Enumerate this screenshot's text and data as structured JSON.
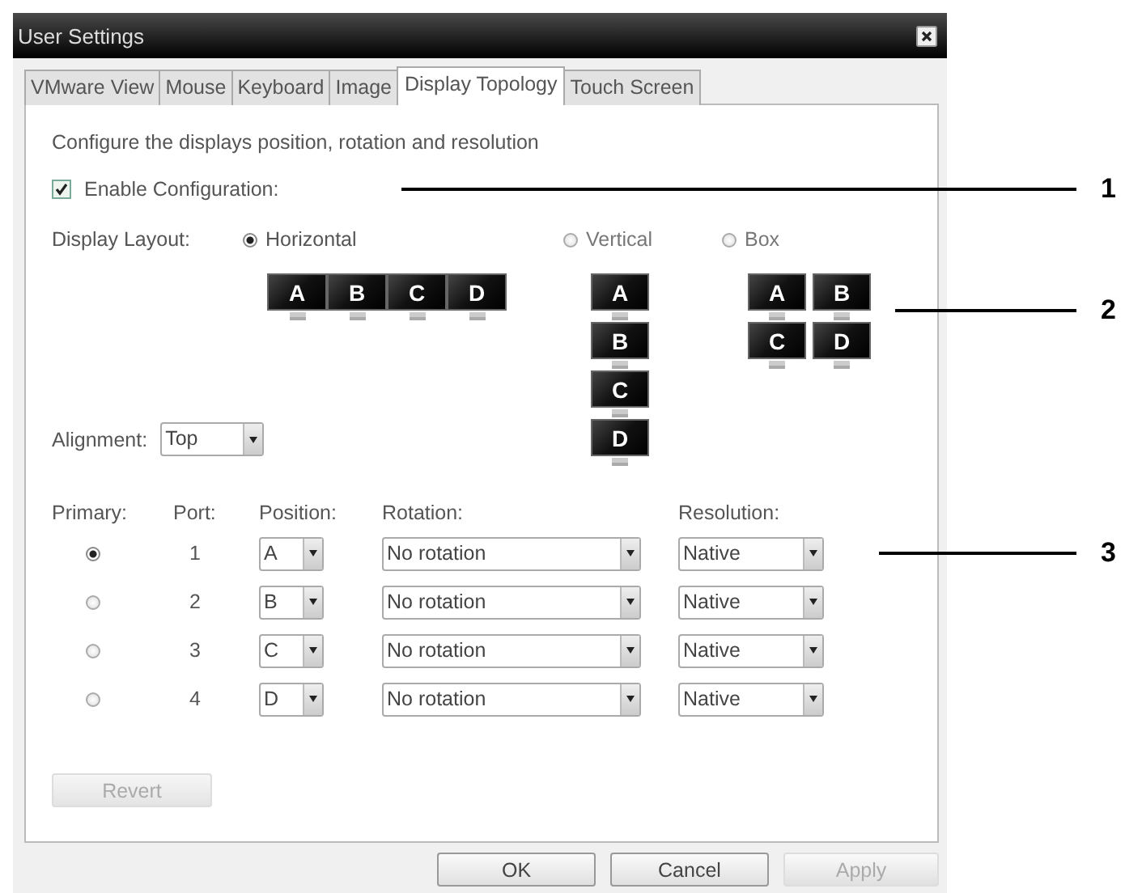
{
  "window": {
    "title": "User Settings"
  },
  "tabs": [
    {
      "label": "VMware View",
      "selected": false
    },
    {
      "label": "Mouse",
      "selected": false
    },
    {
      "label": "Keyboard",
      "selected": false
    },
    {
      "label": "Image",
      "selected": false
    },
    {
      "label": "Display Topology",
      "selected": true
    },
    {
      "label": "Touch Screen",
      "selected": false
    }
  ],
  "description": "Configure the displays position, rotation and resolution",
  "enable_configuration": {
    "label": "Enable Configuration:",
    "checked": true
  },
  "display_layout": {
    "label": "Display Layout:",
    "options": [
      {
        "kind": "horizontal",
        "label": "Horizontal",
        "selected": true,
        "displays": [
          "A",
          "B",
          "C",
          "D"
        ]
      },
      {
        "kind": "vertical",
        "label": "Vertical",
        "selected": false,
        "displays": [
          "A",
          "B",
          "C",
          "D"
        ]
      },
      {
        "kind": "box",
        "label": "Box",
        "selected": false,
        "displays": [
          "A",
          "B",
          "C",
          "D"
        ]
      }
    ]
  },
  "alignment": {
    "label": "Alignment:",
    "value": "Top"
  },
  "displays_table": {
    "columns": [
      "Primary:",
      "Port:",
      "Position:",
      "Rotation:",
      "Resolution:"
    ],
    "rows": [
      {
        "selected": true,
        "port": "1",
        "position": "A",
        "rotation": "No rotation",
        "resolution": "Native"
      },
      {
        "selected": false,
        "port": "2",
        "position": "B",
        "rotation": "No rotation",
        "resolution": "Native"
      },
      {
        "selected": false,
        "port": "3",
        "position": "C",
        "rotation": "No rotation",
        "resolution": "Native"
      },
      {
        "selected": false,
        "port": "4",
        "position": "D",
        "rotation": "No rotation",
        "resolution": "Native"
      }
    ]
  },
  "revert_button": {
    "label": "Revert",
    "disabled": true
  },
  "buttons": [
    {
      "label": "OK",
      "disabled": false
    },
    {
      "label": "Cancel",
      "disabled": false
    },
    {
      "label": "Apply",
      "disabled": true
    }
  ],
  "callouts": [
    {
      "label": "1"
    },
    {
      "label": "2"
    },
    {
      "label": "3"
    }
  ]
}
